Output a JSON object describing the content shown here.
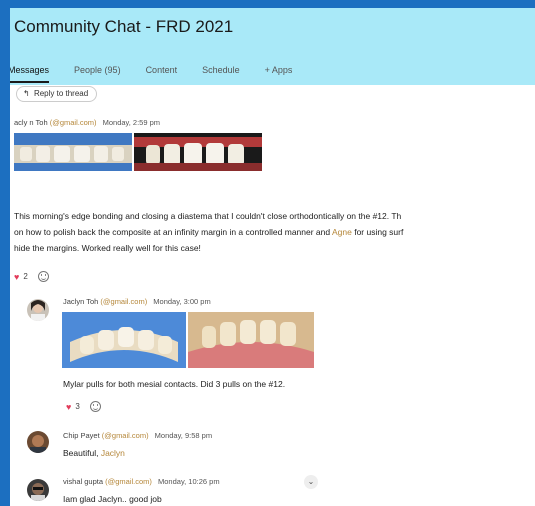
{
  "header": {
    "title": "Community Chat - FRD 2021",
    "tabs": [
      {
        "label": "Messages"
      },
      {
        "label": "People (95)"
      },
      {
        "label": "Content"
      },
      {
        "label": "Schedule"
      },
      {
        "label": "+ Apps"
      }
    ]
  },
  "thread": {
    "reply_label": "Reply to thread",
    "main_post": {
      "author": "acly n Toh",
      "email": "(@gmail.com)",
      "time": "Monday, 2:59 pm",
      "line1": "This morning's edge bonding and closing a diastema that I couldn't close orthodontically on the #12. Th",
      "line2a": "on how to polish back the composite at an infinity margin in a controlled manner and ",
      "line2_mention": "Agne",
      "line2b": " for using surf",
      "line3": "hide the margins. Worked really well for this case!",
      "reaction_count": "2"
    },
    "replies": [
      {
        "author": "Jaclyn Toh",
        "email": "(@gmail.com)",
        "time": "Monday, 3:00 pm",
        "text": "Mylar pulls for both mesial contacts. Did 3 pulls on the #12.",
        "reaction_count": "3"
      },
      {
        "author": "Chip Payet",
        "email": "(@gmail.com)",
        "time": "Monday, 9:58 pm",
        "text_a": "Beautiful, ",
        "text_mention": "Jaclyn"
      },
      {
        "author": "vishal gupta",
        "email": "(@gmail.com)",
        "time": "Monday, 10:26 pm",
        "text": "Iam glad Jaclyn.. good job"
      }
    ]
  },
  "colors": {
    "header_bg": "#a9e9f8",
    "mention": "#b5873a",
    "heart": "#e23b5a",
    "outer_bg": "#1c6fc0"
  }
}
